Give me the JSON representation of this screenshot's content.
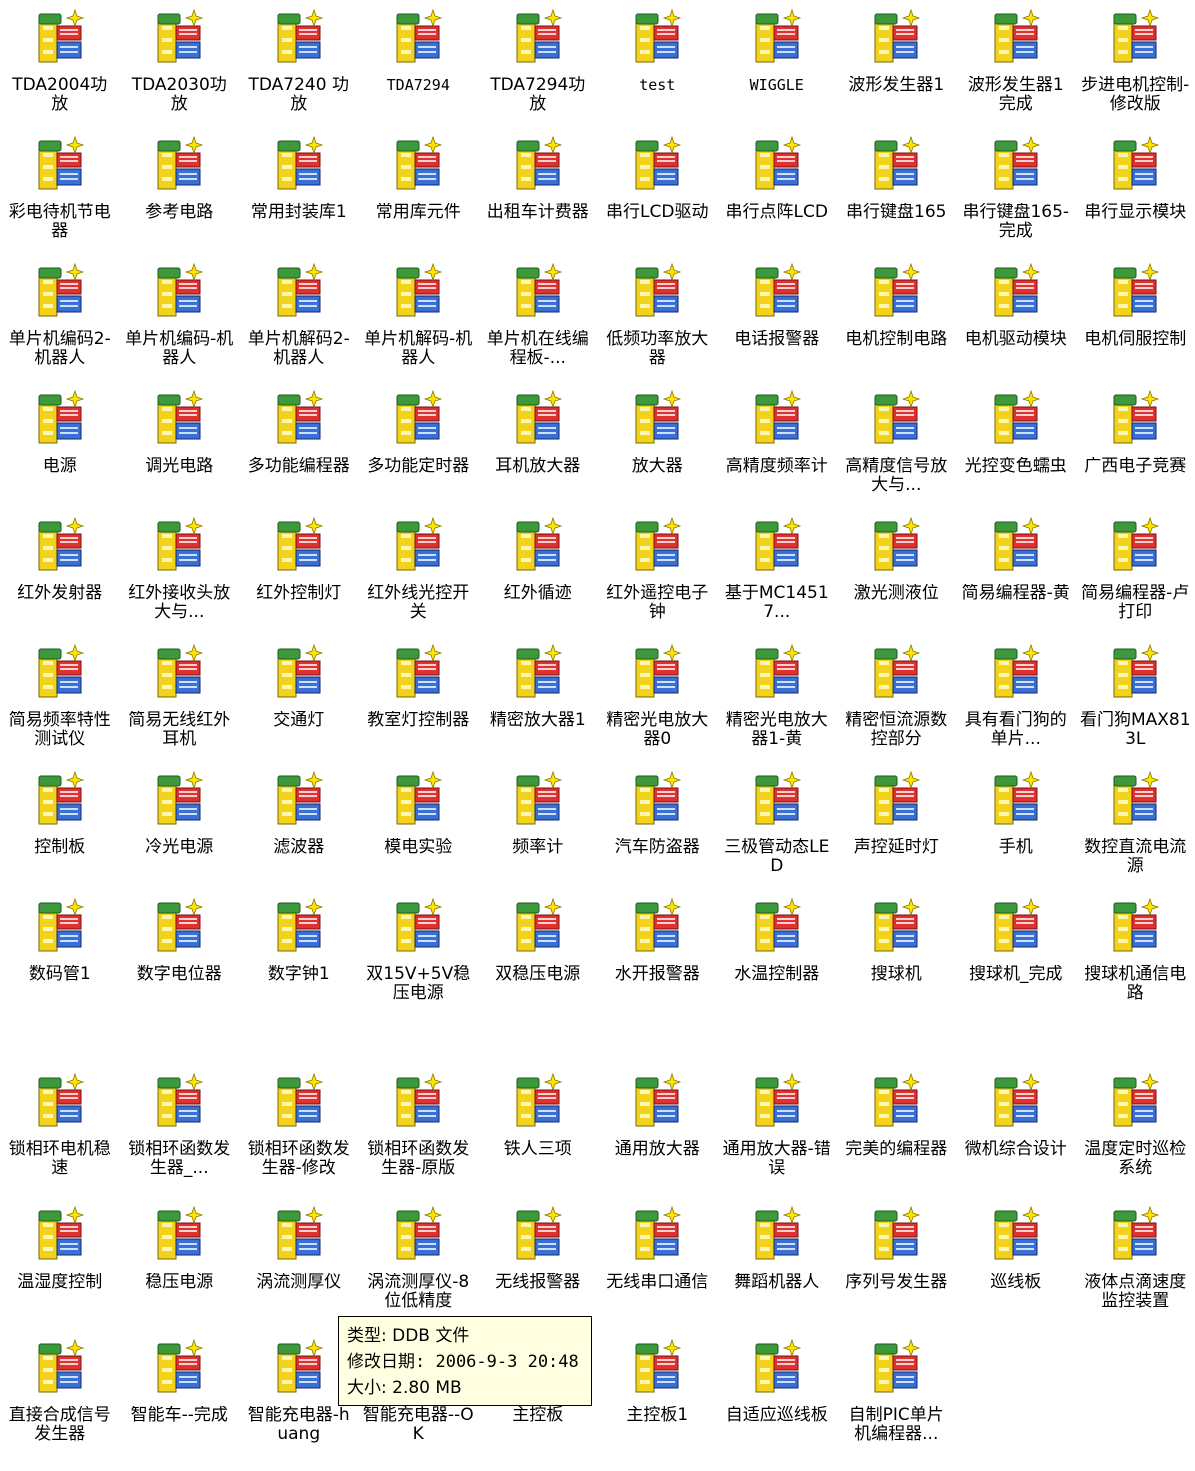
{
  "desktop": {
    "icon_name": "ddb-file-icon",
    "upper_files": [
      "TDA2004功放",
      "TDA2030功放",
      "TDA7240 功放",
      "TDA7294",
      "TDA7294功放",
      "test",
      "WIGGLE",
      "波形发生器1",
      "波形发生器1完成",
      "步进电机控制-修改版",
      "彩电待机节电器",
      "参考电路",
      "常用封装库1",
      "常用库元件",
      "出租车计费器",
      "串行LCD驱动",
      "串行点阵LCD",
      "串行键盘165",
      "串行键盘165-完成",
      "串行显示模块",
      "单片机编码2-机器人",
      "单片机编码-机器人",
      "单片机解码2-机器人",
      "单片机解码-机器人",
      "单片机在线编程板-...",
      "低频功率放大器",
      "电话报警器",
      "电机控制电路",
      "电机驱动模块",
      "电机伺服控制",
      "电源",
      "调光电路",
      "多功能编程器",
      "多功能定时器",
      "耳机放大器",
      "放大器",
      "高精度频率计",
      "高精度信号放大与...",
      "光控变色蠕虫",
      "广西电子竞赛",
      "红外发射器",
      "红外接收头放大与...",
      "红外控制灯",
      "红外线光控开关",
      "红外循迹",
      "红外遥控电子钟",
      "基于MC14517...",
      "激光测液位",
      "简易编程器-黄",
      "简易编程器-卢打印",
      "简易频率特性测试仪",
      "简易无线红外耳机",
      "交通灯",
      "教室灯控制器",
      "精密放大器1",
      "精密光电放大器0",
      "精密光电放大器1-黄",
      "精密恒流源数控部分",
      "具有看门狗的单片...",
      "看门狗MAX813L",
      "控制板",
      "冷光电源",
      "滤波器",
      "模电实验",
      "频率计",
      "汽车防盗器",
      "三极管动态LED",
      "声控延时灯",
      "手机",
      "数控直流电流源",
      "数码管1",
      "数字电位器",
      "数字钟1",
      "双15V+5V稳压电源",
      "双稳压电源",
      "水开报警器",
      "水温控制器",
      "搜球机",
      "搜球机_完成",
      "搜球机通信电路"
    ],
    "lower_files": [
      "锁相环电机稳速",
      "锁相环函数发生器_...",
      "锁相环函数发生器-修改",
      "锁相环函数发生器-原版",
      "铁人三项",
      "通用放大器",
      "通用放大器-错误",
      "完美的编程器",
      "微机综合设计",
      "温度定时巡检系统",
      "温湿度控制",
      "稳压电源",
      "涡流测厚仪",
      "涡流测厚仪-8位低精度",
      "无线报警器",
      "无线串口通信",
      "舞蹈机器人",
      "序列号发生器",
      "巡线板",
      "液体点滴速度监控装置",
      "直接合成信号发生器",
      "智能车--完成",
      "智能充电器-huang",
      "智能充电器--OK",
      "主控板",
      "主控板1",
      "自适应巡线板",
      "自制PIC单片机编程器..."
    ]
  },
  "tooltip": {
    "type_line": "类型: DDB 文件",
    "date_line": "修改日期: 2006-9-3 20:48",
    "size_line": "大小: 2.80 MB"
  },
  "colors": {
    "bg": "#ffffff",
    "tooltip_bg": "#ffffe1",
    "icon_yellow": "#f2d21b",
    "icon_green": "#3c9a3c",
    "icon_red": "#e03131",
    "icon_blue": "#3a6fd6"
  }
}
